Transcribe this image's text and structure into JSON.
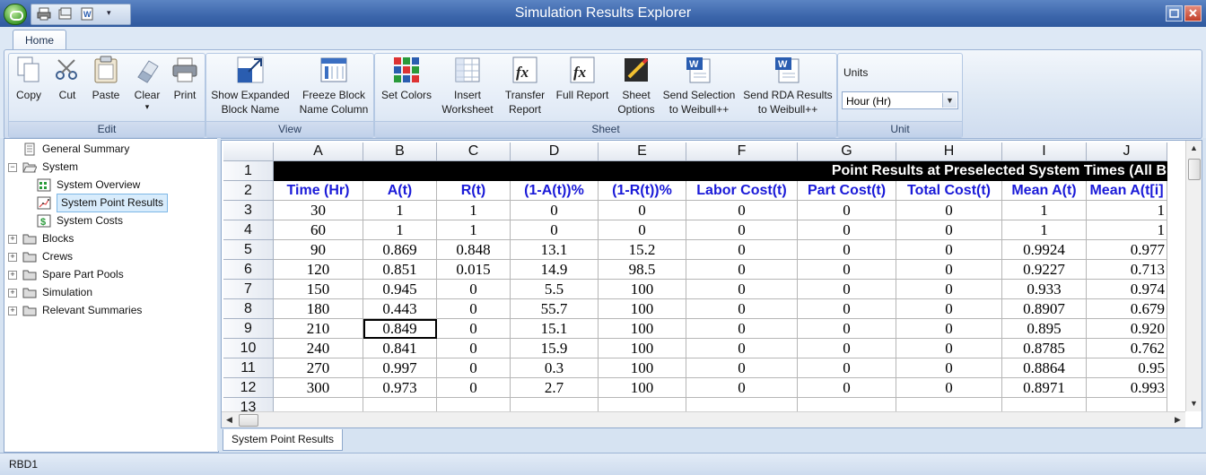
{
  "window": {
    "title": "Simulation Results Explorer"
  },
  "ribbon": {
    "tab": "Home",
    "groups": [
      {
        "label": "Edit",
        "buttons": [
          {
            "label": "Copy",
            "icon": "copy-icon"
          },
          {
            "label": "Cut",
            "icon": "scissors-icon"
          },
          {
            "label": "Paste",
            "icon": "paste-icon"
          },
          {
            "label": "Clear",
            "icon": "eraser-icon",
            "has_dropdown": true
          },
          {
            "label": "Print",
            "icon": "printer-icon"
          }
        ]
      },
      {
        "label": "View",
        "buttons": [
          {
            "label": "Show Expanded\nBlock Name",
            "icon": "expand-icon"
          },
          {
            "label": "Freeze Block\nName Column",
            "icon": "freeze-column-icon"
          }
        ]
      },
      {
        "label": "Sheet",
        "buttons": [
          {
            "label": "Set Colors",
            "icon": "color-grid-icon"
          },
          {
            "label": "Insert\nWorksheet",
            "icon": "insert-worksheet-icon"
          },
          {
            "label": "Transfer\nReport",
            "icon": "function-icon"
          },
          {
            "label": "Full Report",
            "icon": "function-icon"
          },
          {
            "label": "Sheet\nOptions",
            "icon": "sheet-options-icon"
          },
          {
            "label": "Send Selection\nto Weibull++",
            "icon": "weibull-icon"
          },
          {
            "label": "Send RDA Results\nto Weibull++",
            "icon": "weibull-icon"
          }
        ]
      },
      {
        "label": "Unit",
        "units_label": "Units",
        "units_value": "Hour (Hr)"
      }
    ]
  },
  "tree": [
    {
      "label": "General Summary",
      "icon": "document-icon",
      "level": 1,
      "expander": ""
    },
    {
      "label": "System",
      "icon": "folder-open-icon",
      "level": 0,
      "expander": "−"
    },
    {
      "label": "System Overview",
      "icon": "system-overview-icon",
      "level": 2,
      "expander": ""
    },
    {
      "label": "System Point Results",
      "icon": "point-results-icon",
      "level": 2,
      "expander": "",
      "selected": true
    },
    {
      "label": "System Costs",
      "icon": "dollar-icon",
      "level": 2,
      "expander": ""
    },
    {
      "label": "Blocks",
      "icon": "folder-icon",
      "level": 0,
      "expander": "+"
    },
    {
      "label": "Crews",
      "icon": "folder-icon",
      "level": 0,
      "expander": "+"
    },
    {
      "label": "Spare Part Pools",
      "icon": "folder-icon",
      "level": 0,
      "expander": "+"
    },
    {
      "label": "Simulation",
      "icon": "folder-icon",
      "level": 0,
      "expander": "+"
    },
    {
      "label": "Relevant Summaries",
      "icon": "folder-icon",
      "level": 0,
      "expander": "+"
    }
  ],
  "sheet": {
    "columns": [
      "A",
      "B",
      "C",
      "D",
      "E",
      "F",
      "G",
      "H",
      "I",
      "J"
    ],
    "row_numbers": [
      "1",
      "2",
      "3",
      "4",
      "5",
      "6",
      "7",
      "8",
      "9",
      "10",
      "11",
      "12",
      "13"
    ],
    "banner": "Point Results at Preselected System Times (All B",
    "headers": [
      "Time (Hr)",
      "A(t)",
      "R(t)",
      "(1-A(t))%",
      "(1-R(t))%",
      "Labor Cost(t)",
      "Part Cost(t)",
      "Total Cost(t)",
      "Mean A(t)",
      "Mean A(t[i]"
    ],
    "rows": [
      [
        "30",
        "1",
        "1",
        "0",
        "0",
        "0",
        "0",
        "0",
        "1",
        "1"
      ],
      [
        "60",
        "1",
        "1",
        "0",
        "0",
        "0",
        "0",
        "0",
        "1",
        "1"
      ],
      [
        "90",
        "0.869",
        "0.848",
        "13.1",
        "15.2",
        "0",
        "0",
        "0",
        "0.9924",
        "0.977"
      ],
      [
        "120",
        "0.851",
        "0.015",
        "14.9",
        "98.5",
        "0",
        "0",
        "0",
        "0.9227",
        "0.713"
      ],
      [
        "150",
        "0.945",
        "0",
        "5.5",
        "100",
        "0",
        "0",
        "0",
        "0.933",
        "0.974"
      ],
      [
        "180",
        "0.443",
        "0",
        "55.7",
        "100",
        "0",
        "0",
        "0",
        "0.8907",
        "0.679"
      ],
      [
        "210",
        "0.849",
        "0",
        "15.1",
        "100",
        "0",
        "0",
        "0",
        "0.895",
        "0.920"
      ],
      [
        "240",
        "0.841",
        "0",
        "15.9",
        "100",
        "0",
        "0",
        "0",
        "0.8785",
        "0.762"
      ],
      [
        "270",
        "0.997",
        "0",
        "0.3",
        "100",
        "0",
        "0",
        "0",
        "0.8864",
        "0.95"
      ],
      [
        "300",
        "0.973",
        "0",
        "2.7",
        "100",
        "0",
        "0",
        "0",
        "0.8971",
        "0.993"
      ]
    ],
    "tab": "System Point Results"
  },
  "status": {
    "text": "RBD1"
  }
}
